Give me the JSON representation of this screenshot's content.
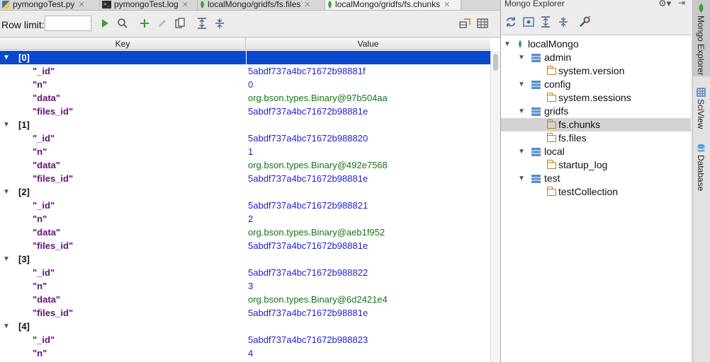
{
  "tabs": [
    {
      "label": "pymongoTest.py",
      "icon": "python-file-icon",
      "active": false
    },
    {
      "label": "pymongoTest.log",
      "icon": "log-file-icon",
      "active": false
    },
    {
      "label": "localMongo/gridfs/fs.files",
      "icon": "mongo-leaf-icon",
      "active": false
    },
    {
      "label": "localMongo/gridfs/fs.chunks",
      "icon": "mongo-leaf-icon",
      "active": true
    }
  ],
  "toolbar": {
    "row_limit_label": "Row limit:",
    "row_limit_value": "",
    "buttons": [
      "run-icon",
      "find-icon",
      "add-icon",
      "edit-icon",
      "copy-icon",
      "expand-all-icon",
      "collapse-all-icon",
      "aggregate-icon",
      "table-view-icon"
    ]
  },
  "grid": {
    "columns": {
      "key": "Key",
      "value": "Value"
    },
    "rows": [
      {
        "kind": "doc",
        "key": "[0]",
        "value": "",
        "selected": true
      },
      {
        "kind": "field",
        "key": "\"_id\"",
        "value": "5abdf737a4bc71672b98881f",
        "color": "blue"
      },
      {
        "kind": "field",
        "key": "\"n\"",
        "value": "0",
        "color": "blue"
      },
      {
        "kind": "field",
        "key": "\"data\"",
        "value": "org.bson.types.Binary@97b504aa",
        "color": "green"
      },
      {
        "kind": "field",
        "key": "\"files_id\"",
        "value": "5abdf737a4bc71672b98881e",
        "color": "blue"
      },
      {
        "kind": "doc",
        "key": "[1]",
        "value": ""
      },
      {
        "kind": "field",
        "key": "\"_id\"",
        "value": "5abdf737a4bc71672b988820",
        "color": "blue"
      },
      {
        "kind": "field",
        "key": "\"n\"",
        "value": "1",
        "color": "blue"
      },
      {
        "kind": "field",
        "key": "\"data\"",
        "value": "org.bson.types.Binary@492e7568",
        "color": "green"
      },
      {
        "kind": "field",
        "key": "\"files_id\"",
        "value": "5abdf737a4bc71672b98881e",
        "color": "blue"
      },
      {
        "kind": "doc",
        "key": "[2]",
        "value": ""
      },
      {
        "kind": "field",
        "key": "\"_id\"",
        "value": "5abdf737a4bc71672b988821",
        "color": "blue"
      },
      {
        "kind": "field",
        "key": "\"n\"",
        "value": "2",
        "color": "blue"
      },
      {
        "kind": "field",
        "key": "\"data\"",
        "value": "org.bson.types.Binary@aeb1f952",
        "color": "green"
      },
      {
        "kind": "field",
        "key": "\"files_id\"",
        "value": "5abdf737a4bc71672b98881e",
        "color": "blue"
      },
      {
        "kind": "doc",
        "key": "[3]",
        "value": ""
      },
      {
        "kind": "field",
        "key": "\"_id\"",
        "value": "5abdf737a4bc71672b988822",
        "color": "blue"
      },
      {
        "kind": "field",
        "key": "\"n\"",
        "value": "3",
        "color": "blue"
      },
      {
        "kind": "field",
        "key": "\"data\"",
        "value": "org.bson.types.Binary@6d2421e4",
        "color": "green"
      },
      {
        "kind": "field",
        "key": "\"files_id\"",
        "value": "5abdf737a4bc71672b98881e",
        "color": "blue"
      },
      {
        "kind": "doc",
        "key": "[4]",
        "value": ""
      },
      {
        "kind": "field",
        "key": "\"_id\"",
        "value": "5abdf737a4bc71672b988823",
        "color": "blue"
      },
      {
        "kind": "field",
        "key": "\"n\"",
        "value": "4",
        "color": "blue"
      }
    ]
  },
  "explorer": {
    "title": "Mongo Explorer",
    "toolbar_icons": [
      "refresh-icon",
      "view-icon",
      "expand-all-icon",
      "collapse-all-icon",
      "settings-wrench-icon"
    ],
    "tree": [
      {
        "label": "localMongo",
        "type": "server",
        "level": 0,
        "expanded": true
      },
      {
        "label": "admin",
        "type": "db",
        "level": 1,
        "expanded": true
      },
      {
        "label": "system.version",
        "type": "collection",
        "level": 2
      },
      {
        "label": "config",
        "type": "db",
        "level": 1,
        "expanded": true
      },
      {
        "label": "system.sessions",
        "type": "collection",
        "level": 2
      },
      {
        "label": "gridfs",
        "type": "db",
        "level": 1,
        "expanded": true
      },
      {
        "label": "fs.chunks",
        "type": "collection",
        "level": 2,
        "selected": true
      },
      {
        "label": "fs.files",
        "type": "collection",
        "level": 2
      },
      {
        "label": "local",
        "type": "db",
        "level": 1,
        "expanded": true
      },
      {
        "label": "startup_log",
        "type": "collection",
        "level": 2
      },
      {
        "label": "test",
        "type": "db",
        "level": 1,
        "expanded": true
      },
      {
        "label": "testCollection",
        "type": "collection",
        "level": 2
      }
    ]
  },
  "side_rail": [
    {
      "label": "Mongo Explorer",
      "icon": "mongo-explorer-icon",
      "active": true
    },
    {
      "label": "SciView",
      "icon": "sciview-icon",
      "active": false
    },
    {
      "label": "Database",
      "icon": "database-icon",
      "active": false
    }
  ],
  "colors": {
    "selection": "#0a48ce",
    "key_field": "#660e7a",
    "value_blue": "#1f1fd1",
    "value_green": "#187318",
    "collection_folder": "#c47c1b"
  }
}
